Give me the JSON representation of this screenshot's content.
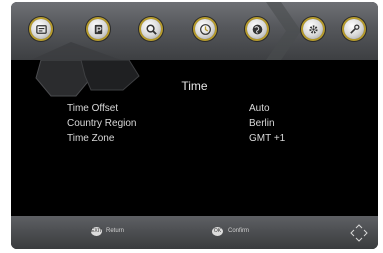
{
  "menu": {
    "tabs": [
      {
        "icon": "info-icon"
      },
      {
        "icon": "parental-lock-icon"
      },
      {
        "icon": "search-icon"
      },
      {
        "icon": "clock-icon"
      },
      {
        "icon": "globe-icon"
      },
      {
        "icon": "gear-icon"
      },
      {
        "icon": "tools-icon"
      }
    ],
    "selected_tab_icon": "clock-icon"
  },
  "page": {
    "title": "Time",
    "settings": [
      {
        "label": "Time Offset",
        "value": "Auto"
      },
      {
        "label": "Country Region",
        "value": "Berlin"
      },
      {
        "label": "Time Zone",
        "value": "GMT +1"
      }
    ]
  },
  "footer": {
    "return_key": "EXIT",
    "return_label": "Return",
    "ok_key": "OK",
    "ok_label": "Confirm",
    "nav_icon": "navigation-arrows-icon"
  },
  "colors": {
    "accent_ring": "#b59a2c",
    "background": "#000000",
    "bar_gray": "#55575b",
    "text": "#d9d9d9"
  }
}
